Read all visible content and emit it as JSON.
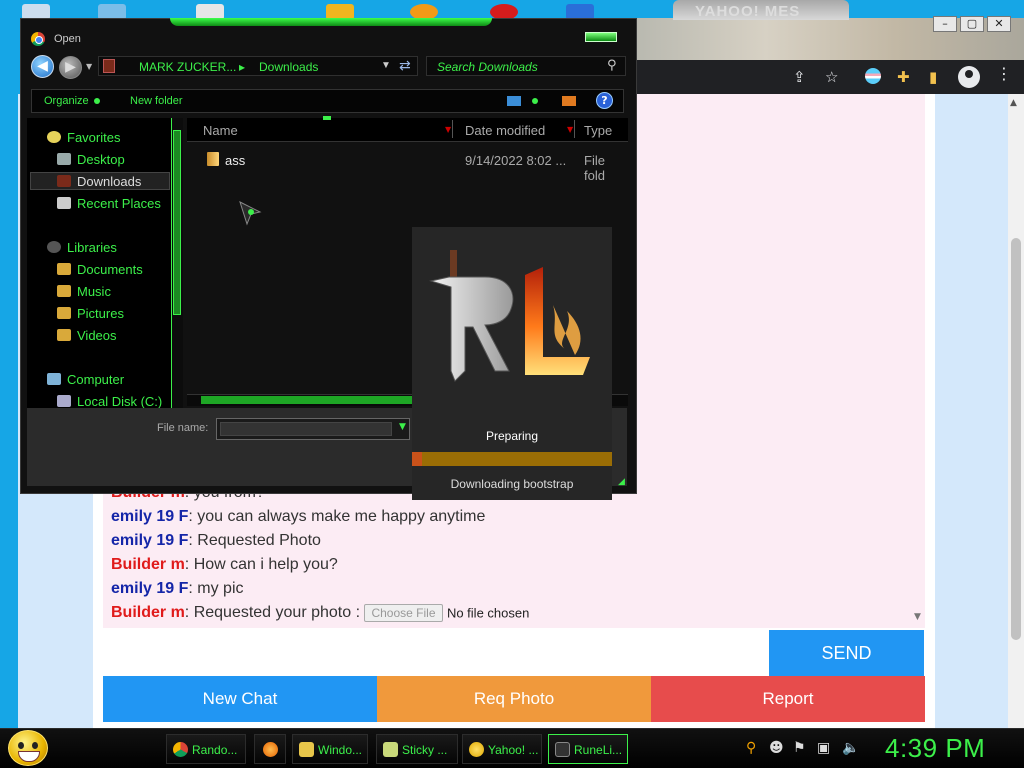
{
  "yahoo_window": {
    "title": "YAHOO! MES"
  },
  "window_controls": {
    "minimize": "–",
    "restore": "▢",
    "close": "✕"
  },
  "dialog": {
    "title": "Open",
    "address": [
      "MARK ZUCKER...",
      "Downloads"
    ],
    "address_sep": "▸",
    "search_placeholder": "Search Downloads",
    "toolbar": {
      "organize": "Organize",
      "new_folder": "New folder",
      "help": "?"
    },
    "nav": {
      "favorites": "Favorites",
      "desktop": "Desktop",
      "downloads": "Downloads",
      "recent": "Recent Places",
      "libraries": "Libraries",
      "documents": "Documents",
      "music": "Music",
      "pictures": "Pictures",
      "videos": "Videos",
      "computer": "Computer",
      "local_disk": "Local Disk (C:)"
    },
    "columns": {
      "name": "Name",
      "date": "Date modified",
      "type": "Type"
    },
    "files": [
      {
        "name": "ass",
        "date": "9/14/2022 8:02 ...",
        "type": "File fold"
      }
    ],
    "file_name_label": "File name:"
  },
  "runelite": {
    "status": "Preparing",
    "detail": "Downloading bootstrap",
    "progress": 0.05
  },
  "chat": {
    "messages": [
      {
        "user": "Builder m",
        "role": "builder",
        "text": ": you from?"
      },
      {
        "user": "emily 19 F",
        "role": "emily",
        "text": ": you can always make me happy anytime"
      },
      {
        "user": "emily 19 F",
        "role": "emily",
        "text": ": Requested Photo"
      },
      {
        "user": "Builder m",
        "role": "builder",
        "text": ": How can i help you?"
      },
      {
        "user": "emily 19 F",
        "role": "emily",
        "text": ": my pic"
      },
      {
        "user": "Builder m",
        "role": "builder",
        "text": ": Requested your photo : "
      }
    ],
    "choose_file": "Choose File",
    "no_file": "No file chosen",
    "send": "SEND",
    "new_chat": "New Chat",
    "req_photo": "Req Photo",
    "report": "Report"
  },
  "taskbar": {
    "items": [
      {
        "label": "Rando...",
        "icon": "chrome-icon"
      },
      {
        "label": "",
        "icon": "firefox-icon"
      },
      {
        "label": "Windo...",
        "icon": "windows-explorer-icon"
      },
      {
        "label": "Sticky ...",
        "icon": "sticky-notes-icon"
      },
      {
        "label": "Yahoo! ...",
        "icon": "yahoo-messenger-icon"
      },
      {
        "label": "RuneLi...",
        "icon": "runelite-icon"
      }
    ],
    "clock": "4:39 PM"
  },
  "colors": {
    "accent_green": "#3cf04a",
    "emily": "#1526a8",
    "builder": "#e01b1b",
    "send": "#2196f3",
    "new_chat": "#2196f3",
    "req_photo": "#f0993c",
    "report": "#e74c4c"
  }
}
